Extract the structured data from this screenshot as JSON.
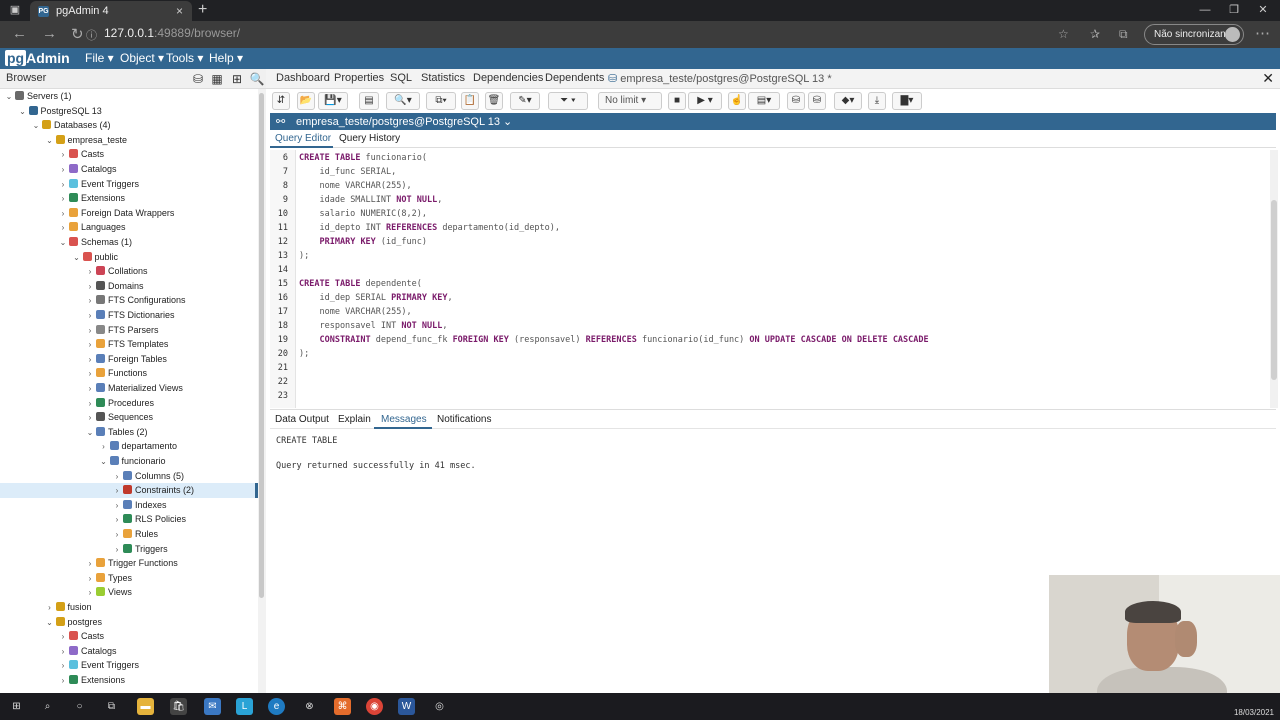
{
  "browser": {
    "tab_title": "pgAdmin 4",
    "url_host": "127.0.0.1",
    "url_rest": ":49889/browser/",
    "sync_label": "Não sincronizando"
  },
  "navbar": {
    "logo_pg": "pg",
    "logo_text": "Admin",
    "menus": [
      "File ▾",
      "Object ▾",
      "Tools ▾",
      "Help ▾"
    ]
  },
  "browser_panel": {
    "title": "Browser",
    "tree": [
      {
        "label": "Servers (1)",
        "arrow": "⌄",
        "icon_color": "#6a6a6a"
      },
      {
        "label": "PostgreSQL 13",
        "arrow": "⌄",
        "icon_color": "#326690"
      },
      {
        "label": "Databases (4)",
        "arrow": "⌄",
        "icon_color": "#d4a017"
      },
      {
        "label": "empresa_teste",
        "arrow": "⌄",
        "icon_color": "#d4a017"
      },
      {
        "label": "Casts",
        "arrow": "›",
        "icon_color": "#d9534f"
      },
      {
        "label": "Catalogs",
        "arrow": "›",
        "icon_color": "#8e6ac8"
      },
      {
        "label": "Event Triggers",
        "arrow": "›",
        "icon_color": "#5bc0de"
      },
      {
        "label": "Extensions",
        "arrow": "›",
        "icon_color": "#2e8b57"
      },
      {
        "label": "Foreign Data Wrappers",
        "arrow": "›",
        "icon_color": "#e9a23b"
      },
      {
        "label": "Languages",
        "arrow": "›",
        "icon_color": "#e9a23b"
      },
      {
        "label": "Schemas (1)",
        "arrow": "⌄",
        "icon_color": "#d9534f"
      },
      {
        "label": "public",
        "arrow": "⌄",
        "icon_color": "#d9534f"
      },
      {
        "label": "Collations",
        "arrow": "›",
        "icon_color": "#c45"
      },
      {
        "label": "Domains",
        "arrow": "›",
        "icon_color": "#555"
      },
      {
        "label": "FTS Configurations",
        "arrow": "›",
        "icon_color": "#777"
      },
      {
        "label": "FTS Dictionaries",
        "arrow": "›",
        "icon_color": "#5a7fb8"
      },
      {
        "label": "FTS Parsers",
        "arrow": "›",
        "icon_color": "#888"
      },
      {
        "label": "FTS Templates",
        "arrow": "›",
        "icon_color": "#e9a23b"
      },
      {
        "label": "Foreign Tables",
        "arrow": "›",
        "icon_color": "#5a7fb8"
      },
      {
        "label": "Functions",
        "arrow": "›",
        "icon_color": "#e9a23b"
      },
      {
        "label": "Materialized Views",
        "arrow": "›",
        "icon_color": "#5a7fb8"
      },
      {
        "label": "Procedures",
        "arrow": "›",
        "icon_color": "#2e8b57"
      },
      {
        "label": "Sequences",
        "arrow": "›",
        "icon_color": "#555"
      },
      {
        "label": "Tables (2)",
        "arrow": "⌄",
        "icon_color": "#5a7fb8"
      },
      {
        "label": "departamento",
        "arrow": "›",
        "icon_color": "#5a7fb8"
      },
      {
        "label": "funcionario",
        "arrow": "⌄",
        "icon_color": "#5a7fb8"
      },
      {
        "label": "Columns (5)",
        "arrow": "›",
        "icon_color": "#5a7fb8"
      },
      {
        "label": "Constraints (2)",
        "arrow": "›",
        "icon_color": "#c0392b"
      },
      {
        "label": "Indexes",
        "arrow": "›",
        "icon_color": "#5a7fb8"
      },
      {
        "label": "RLS Policies",
        "arrow": "›",
        "icon_color": "#2e8b57"
      },
      {
        "label": "Rules",
        "arrow": "›",
        "icon_color": "#e9a23b"
      },
      {
        "label": "Triggers",
        "arrow": "›",
        "icon_color": "#2e8b57"
      },
      {
        "label": "Trigger Functions",
        "arrow": "›",
        "icon_color": "#e9a23b"
      },
      {
        "label": "Types",
        "arrow": "›",
        "icon_color": "#e9a23b"
      },
      {
        "label": "Views",
        "arrow": "›",
        "icon_color": "#9acd32"
      },
      {
        "label": "fusion",
        "arrow": "›",
        "icon_color": "#d4a017"
      },
      {
        "label": "postgres",
        "arrow": "⌄",
        "icon_color": "#d4a017"
      },
      {
        "label": "Casts",
        "arrow": "›",
        "icon_color": "#d9534f"
      },
      {
        "label": "Catalogs",
        "arrow": "›",
        "icon_color": "#8e6ac8"
      },
      {
        "label": "Event Triggers",
        "arrow": "›",
        "icon_color": "#5bc0de"
      },
      {
        "label": "Extensions",
        "arrow": "›",
        "icon_color": "#2e8b57"
      }
    ]
  },
  "main_tabs": [
    "Dashboard",
    "Properties",
    "SQL",
    "Statistics",
    "Dependencies",
    "Dependents"
  ],
  "active_tab": "empresa_teste/postgres@PostgreSQL 13 *",
  "toolbar": {
    "limit": "No limit"
  },
  "connection": "empresa_teste/postgres@PostgreSQL 13 ⌄",
  "editor_tabs": [
    "Query Editor",
    "Query History"
  ],
  "code": [
    {
      "n": "6",
      "t": "CREATE TABLE funcionario("
    },
    {
      "n": "7",
      "t": "    id_func SERIAL,"
    },
    {
      "n": "8",
      "t": "    nome VARCHAR(255),"
    },
    {
      "n": "9",
      "t": "    idade SMALLINT NOT NULL,"
    },
    {
      "n": "10",
      "t": "    salario NUMERIC(8,2),"
    },
    {
      "n": "11",
      "t": "    id_depto INT REFERENCES departamento(id_depto),"
    },
    {
      "n": "12",
      "t": "    PRIMARY KEY (id_func)"
    },
    {
      "n": "13",
      "t": ");"
    },
    {
      "n": "14",
      "t": ""
    },
    {
      "n": "15",
      "t": "CREATE TABLE dependente("
    },
    {
      "n": "16",
      "t": "    id_dep SERIAL PRIMARY KEY,"
    },
    {
      "n": "17",
      "t": "    nome VARCHAR(255),"
    },
    {
      "n": "18",
      "t": "    responsavel INT NOT NULL,"
    },
    {
      "n": "19",
      "t": "    CONSTRAINT depend_func_fk FOREIGN KEY (responsavel) REFERENCES funcionario(id_func) ON UPDATE CASCADE ON DELETE CASCADE"
    },
    {
      "n": "20",
      "t": ");"
    },
    {
      "n": "21",
      "t": ""
    },
    {
      "n": "22",
      "t": ""
    },
    {
      "n": "23",
      "t": ""
    }
  ],
  "result_tabs": [
    "Data Output",
    "Explain",
    "Messages",
    "Notifications"
  ],
  "messages": {
    "line1": "CREATE TABLE",
    "line2": "Query returned successfully in 41 msec."
  },
  "clock": "18/03/2021",
  "colors": {
    "brand": "#326690",
    "keyword": "#7a1a6a"
  }
}
